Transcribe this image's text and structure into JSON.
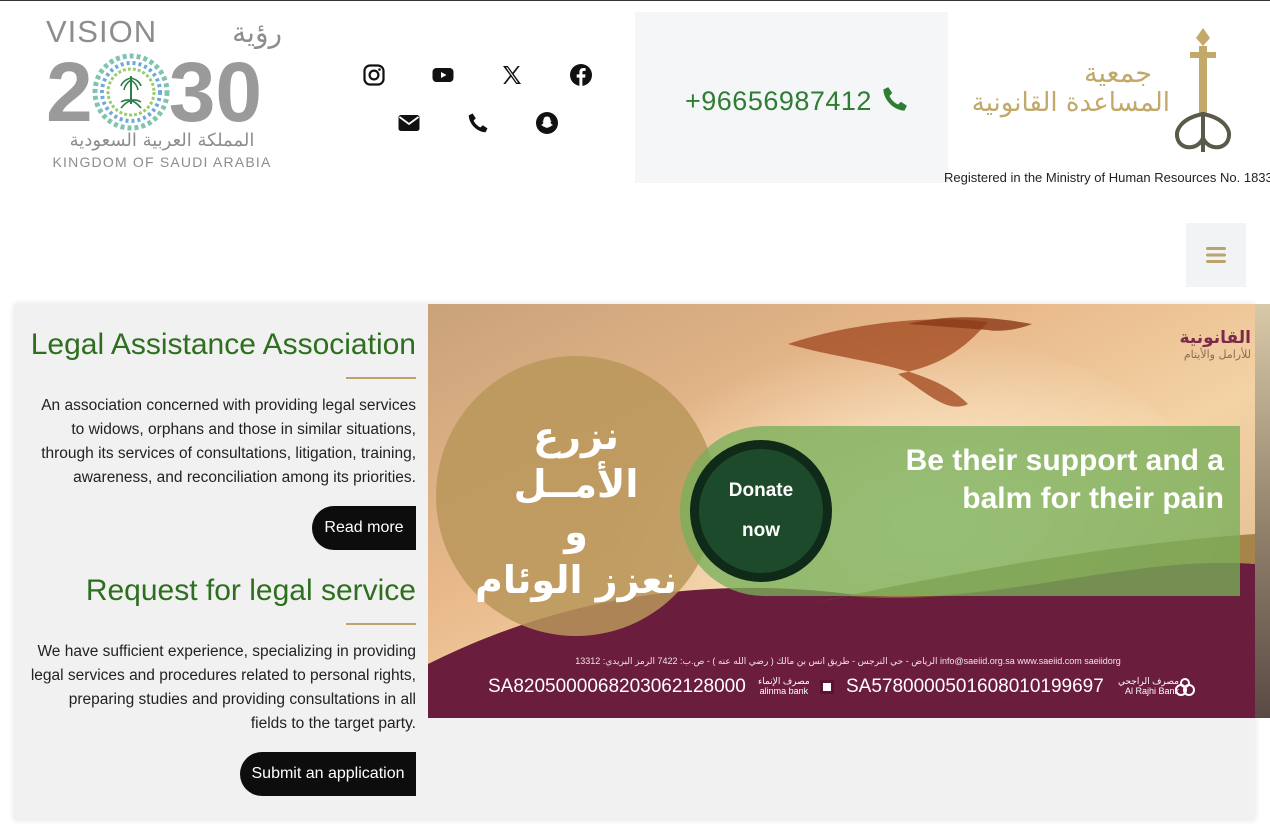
{
  "vision_logo": {
    "vision_word": "VISION",
    "vision_arabic": "رؤية",
    "digit_2": "2",
    "digit_30": "30",
    "kingdom_arabic": "المملكة العربية السعودية",
    "kingdom_english": "KINGDOM OF SAUDI ARABIA"
  },
  "social": [
    {
      "name": "instagram-icon"
    },
    {
      "name": "youtube-icon"
    },
    {
      "name": "x-icon"
    },
    {
      "name": "facebook-icon"
    },
    {
      "name": "mail-icon"
    },
    {
      "name": "phone-icon"
    },
    {
      "name": "snapchat-icon"
    }
  ],
  "contact": {
    "phone": "+96656987412"
  },
  "association_logo": {
    "line1": "جمعية",
    "line2": "المساعدة القانونية",
    "registered": "Registered in the Ministry of Human Resources No. 1833"
  },
  "colors": {
    "brand_green": "#2e6f1f",
    "gold": "#b9a46c",
    "phone_green": "#2e7d32",
    "banner_maroon": "#6b1d3d"
  },
  "sections": {
    "about": {
      "title": "Legal Assistance Association",
      "text": "An association concerned with providing legal services to widows, orphans and those in similar situations, through its services of consultations, litigation, training, awareness, and reconciliation among its priorities.",
      "button": "Read more"
    },
    "request": {
      "title": "Request for legal service",
      "text": "We have sufficient experience, specializing in providing legal services and procedures related to personal rights, preparing studies and providing consultations in all fields to the target party.",
      "button": "Submit an application"
    }
  },
  "banner": {
    "logo_line1": "القانونية",
    "logo_line2": "للأرامل والأيتام",
    "hope_line1": "نزرع الأمــل",
    "hope_line2": "و",
    "hope_line3": "نعزز الوئام",
    "support_text": "Be their support and a balm for their pain",
    "donate_line1": "Donate",
    "donate_line2": "now",
    "info": "الرياض - حي النرجس - طريق انس بن مالك ( رضي الله عنه ) - ص.ب: 7422 الرمز البريدي: 13312   info@saeiid.org.sa   www.saeiid.com   saeiidorg",
    "iban1": "SA8205000068203062128000",
    "bank1_ar": "مصرف الإنماء",
    "bank1_en": "alinma bank",
    "iban2": "SA5780000501608010199697",
    "bank2_ar": "مصرف الراجحي",
    "bank2_en": "Al Rajhi Bank"
  }
}
